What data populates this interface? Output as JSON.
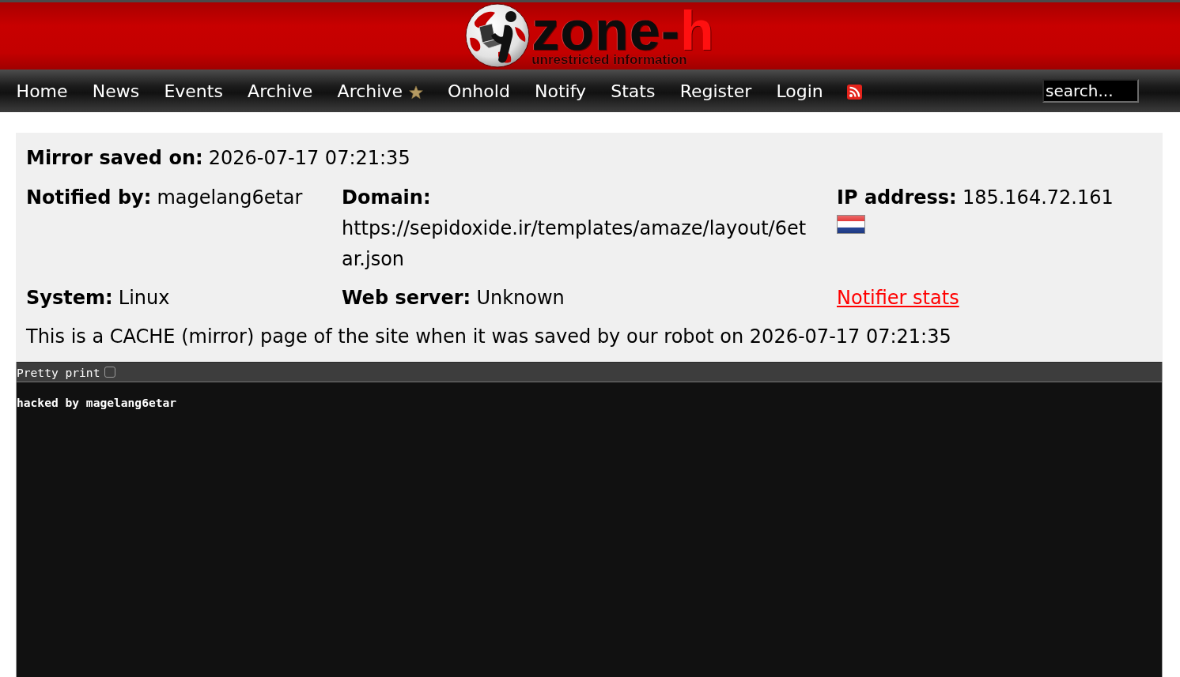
{
  "header": {
    "logo": {
      "wordmark": "zone-",
      "wordmark_accent": "h",
      "tagline": "unrestricted information"
    }
  },
  "nav": {
    "items": [
      {
        "kind": "link",
        "label": "Home"
      },
      {
        "kind": "link",
        "label": "News"
      },
      {
        "kind": "link",
        "label": "Events"
      },
      {
        "kind": "link",
        "label": "Archive"
      },
      {
        "kind": "starred",
        "label": "Archive"
      },
      {
        "kind": "link",
        "label": "Onhold"
      },
      {
        "kind": "link",
        "label": "Notify"
      },
      {
        "kind": "link",
        "label": "Stats"
      },
      {
        "kind": "link",
        "label": "Register"
      },
      {
        "kind": "link",
        "label": "Login"
      },
      {
        "kind": "rss"
      }
    ],
    "search": {
      "placeholder": "search..."
    }
  },
  "mirror": {
    "saved_on": {
      "label": "Mirror saved on:",
      "value": "2026-07-17 07:21:35"
    },
    "fields": [
      {
        "kind": "field",
        "label": "Notified by:",
        "value": "magelang6etar"
      },
      {
        "kind": "field",
        "label": "Domain:",
        "value": "https://sepidoxide.ir/templates/amaze/layout/6etar.json"
      },
      {
        "kind": "field",
        "label": "IP address:",
        "value": "185.164.72.161",
        "flag": true
      },
      {
        "kind": "field",
        "label": "System:",
        "value": "Linux"
      },
      {
        "kind": "field",
        "label": "Web server:",
        "value": "Unknown"
      },
      {
        "kind": "link",
        "label": "Notifier stats"
      }
    ],
    "note": "This is a CACHE (mirror) page of the site when it was saved by our robot on 2026-07-17 07:21:35"
  },
  "source": {
    "pretty_print": {
      "label": "Pretty print",
      "checked": false
    },
    "content": "hacked by magelang6etar"
  }
}
